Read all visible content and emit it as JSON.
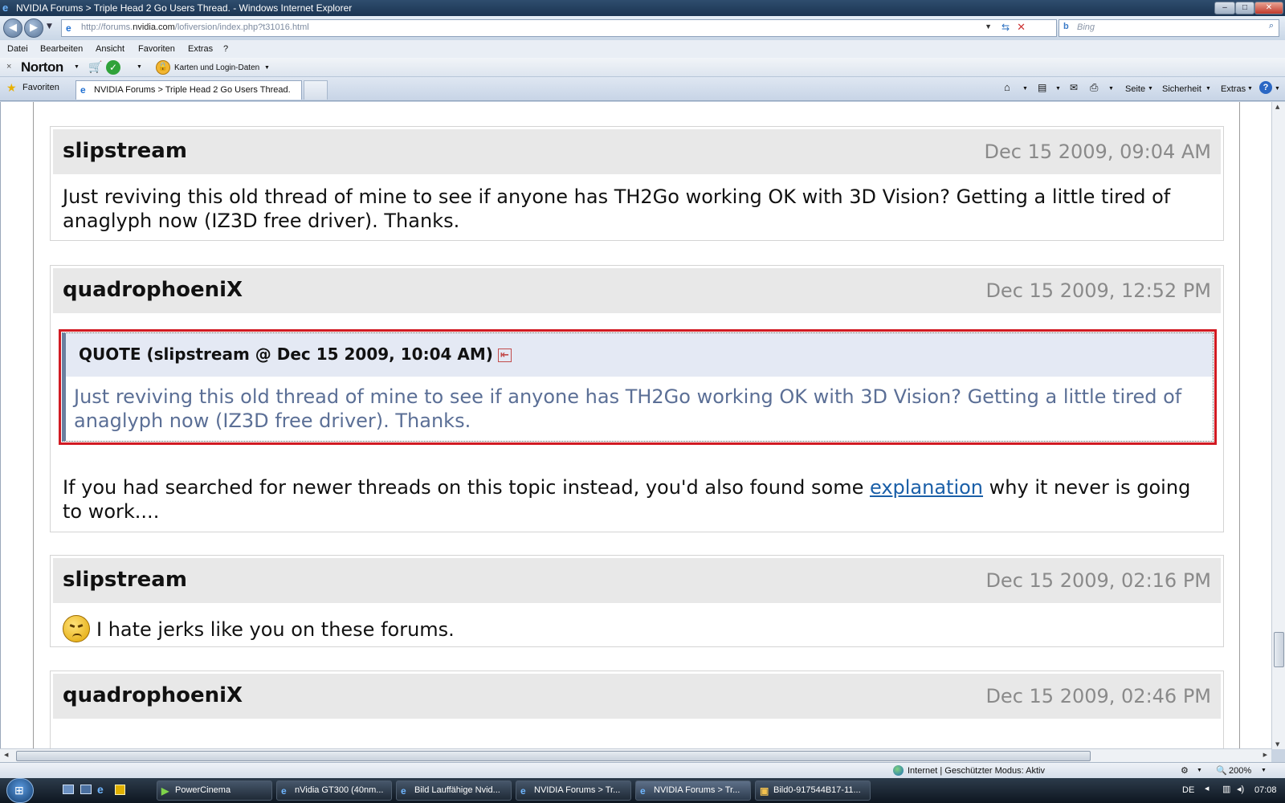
{
  "window": {
    "title": "NVIDIA Forums > Triple Head 2 Go Users Thread. - Windows Internet Explorer",
    "min": "–",
    "max": "□",
    "close": "✕"
  },
  "address": {
    "url_prefix": "http://forums.",
    "url_domain": "nvidia.com",
    "url_path": "/lofiversion/index.php?t31016.html",
    "search_placeholder": "Bing"
  },
  "menu": [
    "Datei",
    "Bearbeiten",
    "Ansicht",
    "Favoriten",
    "Extras",
    "?"
  ],
  "norton": {
    "brand": "Norton",
    "login_label": "Karten und Login-Daten"
  },
  "tabs": {
    "favorites": "Favoriten",
    "active_tab": "NVIDIA Forums > Triple Head 2 Go Users Thread.",
    "commands": [
      "Seite",
      "Sicherheit",
      "Extras"
    ]
  },
  "posts": [
    {
      "author": "slipstream",
      "date": "Dec 15 2009, 09:04 AM",
      "text": "Just reviving this old thread of mine to see if anyone has TH2Go working OK with 3D Vision? Getting a little tired of anaglyph now (IZ3D free driver). Thanks."
    },
    {
      "author": "quadrophoeniX",
      "date": "Dec 15 2009, 12:52 PM",
      "quote_head": "QUOTE (slipstream @ Dec 15 2009, 10:04 AM)",
      "quote_text": "Just reviving this old thread of mine to see if anyone has TH2Go working OK with 3D Vision? Getting a little tired of anaglyph now (IZ3D free driver). Thanks.",
      "text_before": "If you had searched for newer threads on this topic instead, you'd also found some ",
      "link": "explanation",
      "text_after": " why it never is going to work...."
    },
    {
      "author": "slipstream",
      "date": "Dec 15 2009, 02:16 PM",
      "text": "I hate jerks like you on these forums."
    },
    {
      "author": "quadrophoeniX",
      "date": "Dec 15 2009, 02:46 PM"
    }
  ],
  "status": {
    "zone": "Internet | Geschützter Modus: Aktiv",
    "zoom": "200%"
  },
  "taskbar": {
    "items": [
      "PowerCinema",
      "nVidia GT300 (40nm...",
      "Bild Lauffähige Nvid...",
      "NVIDIA Forums > Tr...",
      "NVIDIA Forums > Tr...",
      "Bild0-917544B17-11..."
    ],
    "lang": "DE",
    "clock": "07:08"
  }
}
